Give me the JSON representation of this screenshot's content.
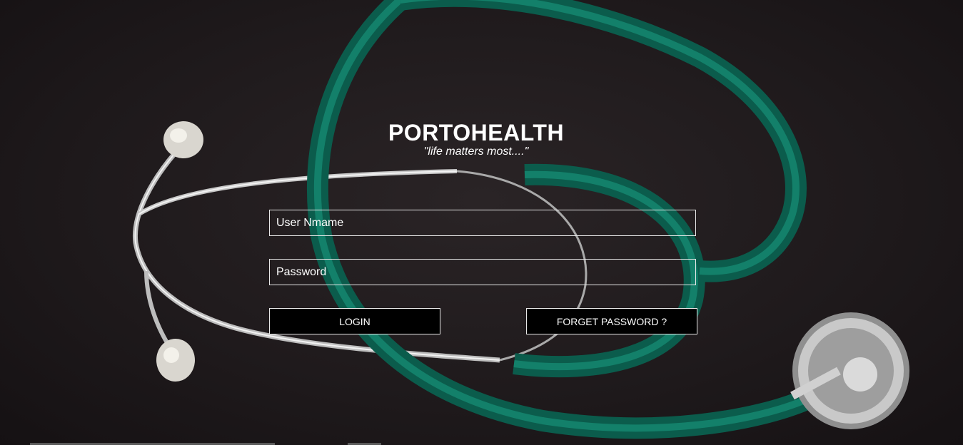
{
  "brand": {
    "title": "PORTOHEALTH",
    "tagline": "\"life matters most....\""
  },
  "login_form": {
    "username_placeholder": "User Nmame",
    "password_placeholder": "Password",
    "login_label": "LOGIN",
    "forget_password_label": "FORGET PASSWORD ?"
  },
  "background": {
    "subject": "stethoscope",
    "tube_color": "#0e6b58",
    "backdrop_color": "#1f1a1c"
  }
}
